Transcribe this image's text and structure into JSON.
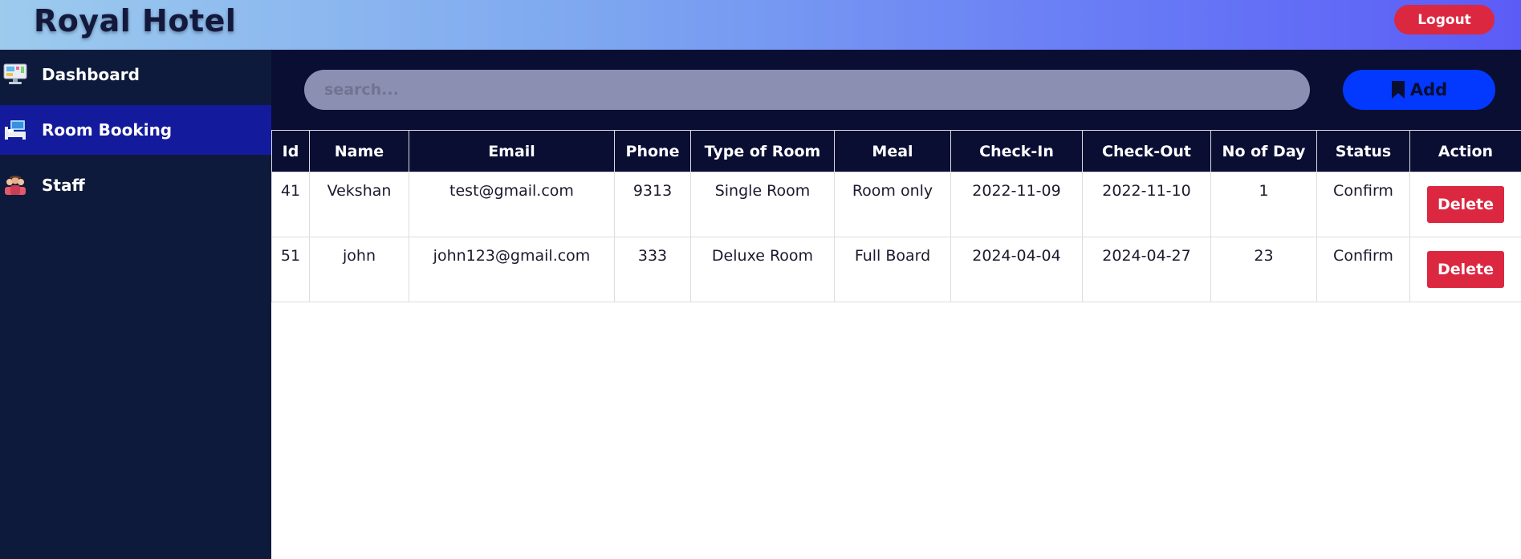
{
  "header": {
    "title": "Royal Hotel",
    "logout_label": "Logout"
  },
  "sidebar": {
    "items": [
      {
        "label": "Dashboard",
        "icon": "monitor-icon",
        "active": false
      },
      {
        "label": "Room Booking",
        "icon": "bed-icon",
        "active": true
      },
      {
        "label": "Staff",
        "icon": "staff-icon",
        "active": false
      }
    ]
  },
  "toolbar": {
    "search_placeholder": "search...",
    "add_label": "Add",
    "add_icon": "bookmark-icon"
  },
  "table": {
    "columns": [
      "Id",
      "Name",
      "Email",
      "Phone",
      "Type of Room",
      "Meal",
      "Check-In",
      "Check-Out",
      "No of Day",
      "Status",
      "Action"
    ],
    "rows": [
      {
        "id": "41",
        "name": "Vekshan",
        "email": "test@gmail.com",
        "phone": "9313",
        "room_type": "Single Room",
        "meal": "Room only",
        "check_in": "2022-11-09",
        "check_out": "2022-11-10",
        "days": "1",
        "status": "Confirm",
        "action": "Delete"
      },
      {
        "id": "51",
        "name": "john",
        "email": "john123@gmail.com",
        "phone": "333",
        "room_type": "Deluxe Room",
        "meal": "Full Board",
        "check_in": "2024-04-04",
        "check_out": "2024-04-27",
        "days": "23",
        "status": "Confirm",
        "action": "Delete"
      }
    ]
  },
  "colors": {
    "header_gradient_start": "#9ccbee",
    "header_gradient_end": "#5b5cf7",
    "sidebar_bg": "#0e1a3b",
    "sidebar_active": "#141a9c",
    "table_header_bg": "#0a0e33",
    "add_button": "#0339ff",
    "danger": "#dc2740"
  }
}
